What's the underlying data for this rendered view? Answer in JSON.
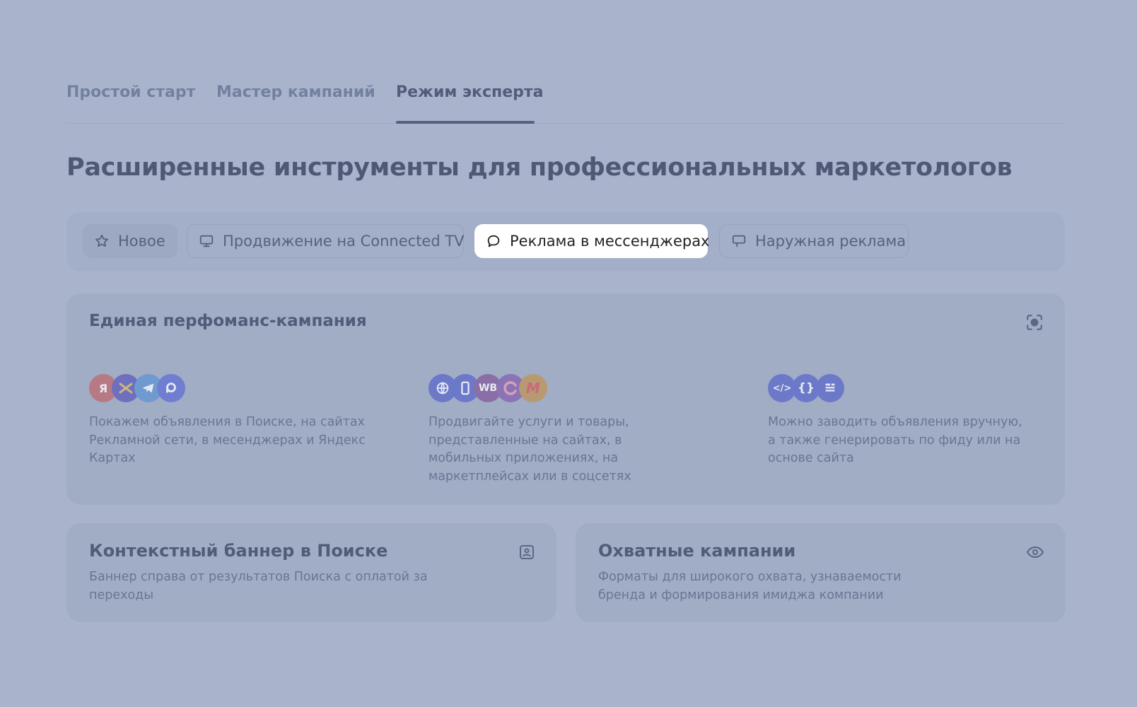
{
  "tabs": [
    {
      "label": "Простой старт"
    },
    {
      "label": "Мастер кампаний"
    },
    {
      "label": "Режим эксперта"
    }
  ],
  "heading": "Расширенные инструменты для профессиональных маркетологов",
  "filters": {
    "items": [
      {
        "label": "Новое",
        "icon": "star-icon"
      },
      {
        "label": "Продвижение на Connected TV",
        "icon": "monitor-icon"
      },
      {
        "label": "Реклама в мессенджерах",
        "icon": "chat-bubble-icon"
      },
      {
        "label": "Наружная реклама",
        "icon": "billboard-icon"
      }
    ],
    "selected": "Реклама в мессенджерах"
  },
  "main_card": {
    "title": "Единая перфоманс-кампания",
    "icon": "focus-target-icon",
    "columns": [
      {
        "logos": [
          {
            "name": "yandex-logo",
            "text": "Я",
            "color": "#b77a85"
          },
          {
            "name": "network-logo",
            "text": "",
            "color": "#6f6fbf"
          },
          {
            "name": "telegram-logo",
            "text": "",
            "color": "#6f9ad0"
          },
          {
            "name": "maps-logo",
            "text": "",
            "color": "#6f7ed0"
          }
        ],
        "description": "Покажем объявления в Поиске, на сайтах Рекламной сети, в месенджерах и Яндекс Картах"
      },
      {
        "logos": [
          {
            "name": "web-logo",
            "text": "",
            "color": "#6c79c9"
          },
          {
            "name": "mobile-logo",
            "text": "",
            "color": "#6c79c9"
          },
          {
            "name": "wildberries-logo",
            "text": "WB",
            "color": "#8a6fa6"
          },
          {
            "name": "sbermegamarket-logo",
            "text": "",
            "color": "#8a74b5"
          },
          {
            "name": "market-logo",
            "text": "М",
            "color": "#b79a6f"
          }
        ],
        "description": "Продвигайте услуги и товары, представленные на сайтах, в мобильных приложениях, на маркетплейсах или в соцсетях"
      },
      {
        "logos": [
          {
            "name": "code-logo",
            "text": "</>",
            "color": "#6c79c9"
          },
          {
            "name": "feed-logo",
            "text": "{}",
            "color": "#6c79c9"
          },
          {
            "name": "site-logo",
            "text": "",
            "color": "#6c79c9"
          }
        ],
        "description": "Можно заводить объявления вручную, а также генерировать по фиду или на основе сайта"
      }
    ]
  },
  "banner_card": {
    "title": "Контекстный баннер в Поиске",
    "description": "Баннер справа от результатов Поиска с оплатой за переходы",
    "icon": "image-frame-icon"
  },
  "reach_card": {
    "title": "Охватные кампании",
    "description": "Форматы для широкого охвата, узнаваемости бренда и формирования имиджа компании",
    "icon": "eye-icon"
  }
}
